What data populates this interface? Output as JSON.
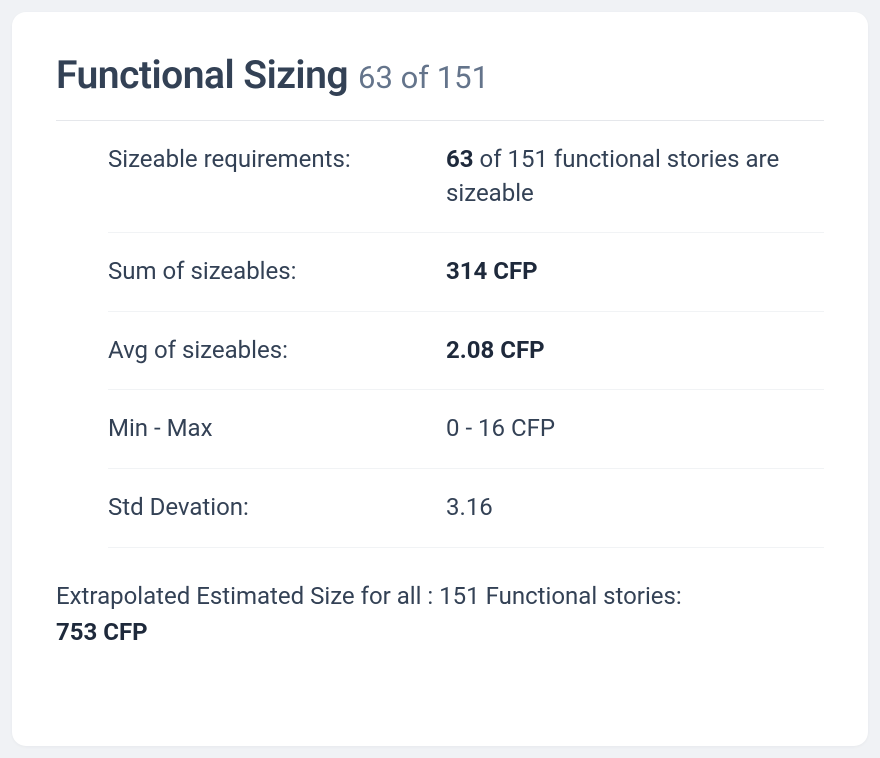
{
  "header": {
    "title": "Functional Sizing",
    "subtitle": "63 of 151"
  },
  "stats": {
    "sizeable_requirements": {
      "label": "Sizeable requirements:",
      "value_bold": "63",
      "value_rest": " of 151 functional stories are sizeable"
    },
    "sum_of_sizeables": {
      "label": "Sum of sizeables:",
      "value_bold": "314 CFP"
    },
    "avg_of_sizeables": {
      "label": "Avg of sizeables:",
      "value_bold": "2.08 CFP"
    },
    "min_max": {
      "label": "Min - Max",
      "value": "0 - 16 CFP"
    },
    "std_deviation": {
      "label": "Std Devation:",
      "value": "3.16"
    }
  },
  "footer": {
    "line1": "Extrapolated Estimated Size for all : 151 Functional stories:",
    "line2_bold": "753 CFP"
  }
}
